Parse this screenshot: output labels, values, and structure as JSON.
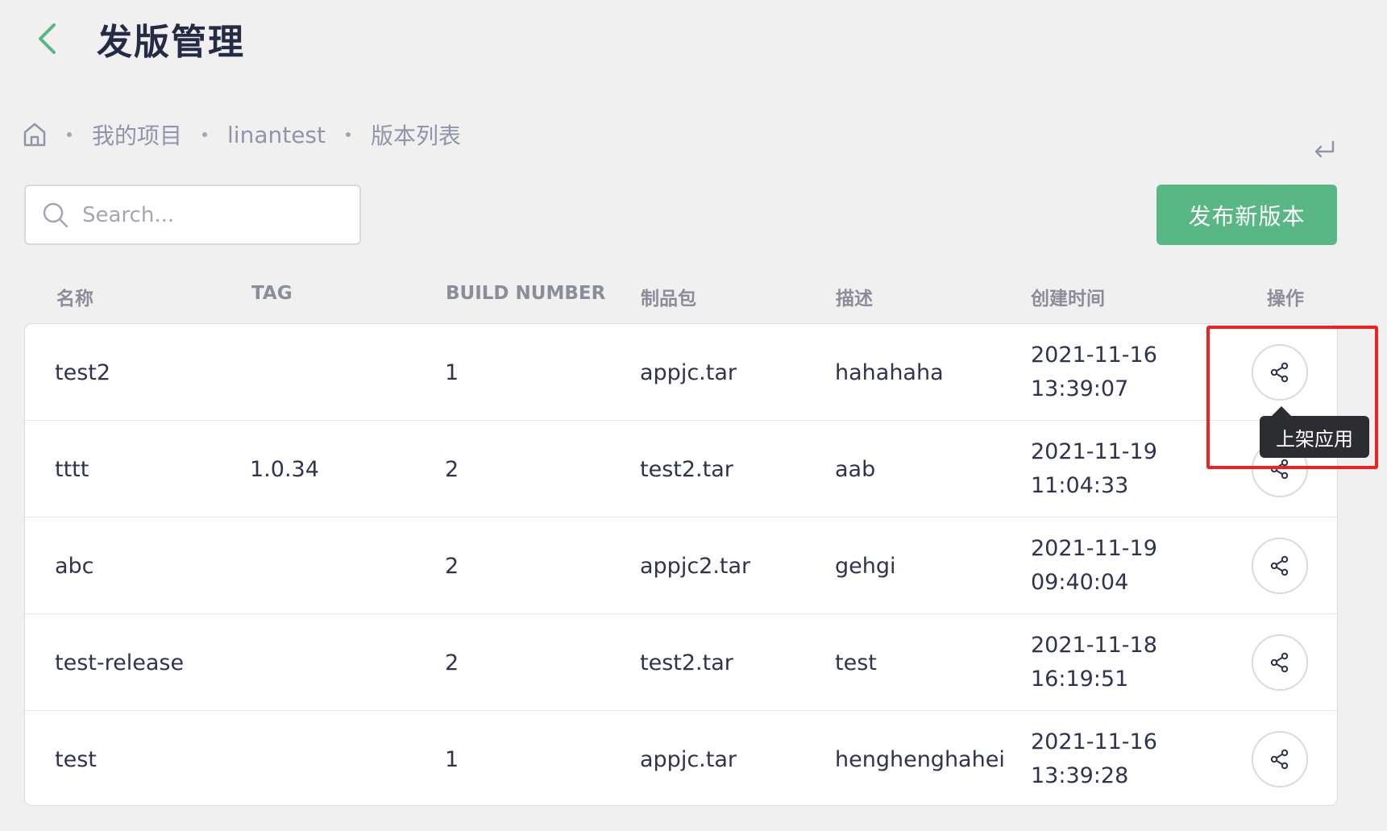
{
  "header": {
    "title": "发版管理"
  },
  "breadcrumb": {
    "items": [
      "我的项目",
      "linantest",
      "版本列表"
    ]
  },
  "search": {
    "placeholder": "Search..."
  },
  "toolbar": {
    "publish_label": "发布新版本"
  },
  "table": {
    "columns": [
      "名称",
      "TAG",
      "BUILD NUMBER",
      "制品包",
      "描述",
      "创建时间",
      "操作"
    ],
    "rows": [
      {
        "name": "test2",
        "tag": "",
        "build": "1",
        "package": "appjc.tar",
        "desc": "hahahaha",
        "date": "2021-11-16",
        "time": "13:39:07"
      },
      {
        "name": "tttt",
        "tag": "1.0.34",
        "build": "2",
        "package": "test2.tar",
        "desc": "aab",
        "date": "2021-11-19",
        "time": "11:04:33"
      },
      {
        "name": "abc",
        "tag": "",
        "build": "2",
        "package": "appjc2.tar",
        "desc": "gehgi",
        "date": "2021-11-19",
        "time": "09:40:04"
      },
      {
        "name": "test-release",
        "tag": "",
        "build": "2",
        "package": "test2.tar",
        "desc": "test",
        "date": "2021-11-18",
        "time": "16:19:51"
      },
      {
        "name": "test",
        "tag": "",
        "build": "1",
        "package": "appjc.tar",
        "desc": "henghenghahei",
        "date": "2021-11-16",
        "time": "13:39:28"
      }
    ]
  },
  "tooltip": {
    "text": "上架应用"
  },
  "colors": {
    "accent": "#58b785",
    "highlight": "#ee2222",
    "tooltip_bg": "#2c2d30"
  }
}
